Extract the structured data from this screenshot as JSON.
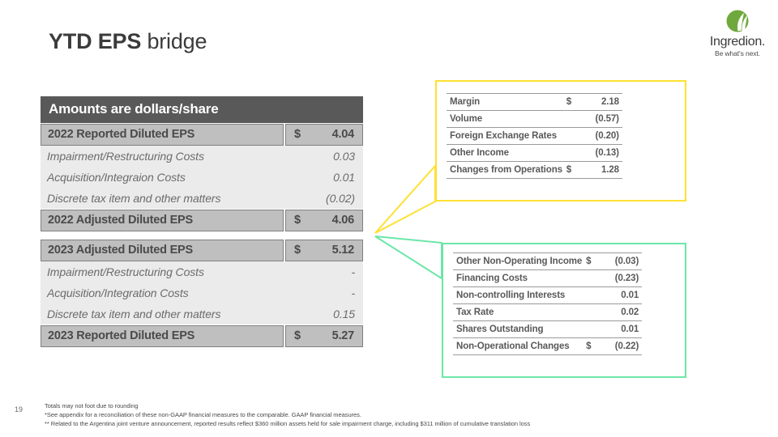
{
  "title": {
    "bold": "YTD EPS",
    "light": "bridge"
  },
  "logo": {
    "word": "Ingredion.",
    "tagline": "Be what's next.",
    "green": "#6fa83c"
  },
  "colors": {
    "header_band": "#595959",
    "bold_row_fill": "#bfbfbf",
    "detail_row_fill": "#ebebeb",
    "yellow_callout": "#ffe033",
    "green_callout": "#6ce6a8"
  },
  "eps_table": {
    "header": "Amounts are dollars/share",
    "rows": [
      {
        "type": "bold",
        "label": "2022 Reported Diluted EPS",
        "currency": "$",
        "value": "4.04"
      },
      {
        "type": "detail",
        "label": "Impairment/Restructuring Costs",
        "currency": "",
        "value": "0.03"
      },
      {
        "type": "detail",
        "label": "Acquisition/Integraion Costs",
        "currency": "",
        "value": "0.01"
      },
      {
        "type": "detail",
        "label": "Discrete tax item and other matters",
        "currency": "",
        "value": "(0.02)"
      },
      {
        "type": "bold",
        "label": "2022 Adjusted Diluted EPS",
        "currency": "$",
        "value": "4.06"
      },
      {
        "type": "gap"
      },
      {
        "type": "bold",
        "label": "2023 Adjusted Diluted EPS",
        "currency": "$",
        "value": "5.12"
      },
      {
        "type": "detail",
        "label": "Impairment/Restructuring Costs",
        "currency": "",
        "value": "-"
      },
      {
        "type": "detail",
        "label": "Acquisition/Integration Costs",
        "currency": "",
        "value": "-"
      },
      {
        "type": "detail",
        "label": "Discrete tax item and other matters",
        "currency": "",
        "value": "0.15"
      },
      {
        "type": "bold",
        "label": "2023 Reported Diluted EPS",
        "currency": "$",
        "value": "5.27"
      }
    ]
  },
  "operations_callout": {
    "rows": [
      {
        "label": "Margin",
        "currency": "$",
        "value": "2.18"
      },
      {
        "label": "Volume",
        "currency": "",
        "value": "(0.57)"
      },
      {
        "label": "Foreign Exchange Rates",
        "currency": "",
        "value": "(0.20)"
      },
      {
        "label": "Other Income",
        "currency": "",
        "value": "(0.13)"
      },
      {
        "label": "Changes from Operations",
        "currency": "$",
        "value": "1.28"
      }
    ]
  },
  "nonoperational_callout": {
    "rows": [
      {
        "label": "Other Non-Operating Income",
        "currency": "$",
        "value": "(0.03)"
      },
      {
        "label": "Financing Costs",
        "currency": "",
        "value": "(0.23)"
      },
      {
        "label": "Non-controlling Interests",
        "currency": "",
        "value": "0.01"
      },
      {
        "label": "Tax Rate",
        "currency": "",
        "value": "0.02"
      },
      {
        "label": "Shares Outstanding",
        "currency": "",
        "value": "0.01"
      },
      {
        "label": "Non-Operational Changes",
        "currency": "$",
        "value": "(0.22)"
      }
    ]
  },
  "slide_number": "19",
  "footnotes": [
    "Totals may not foot due to rounding",
    "*See appendix for a reconciliation of these non-GAAP financial measures to the comparable. GAAP financial measures.",
    "** Related to the Argentina joint venture announcement, reported results reflect $360 million assets held for sale impairment charge, including $311 million of cumulative translation loss"
  ]
}
